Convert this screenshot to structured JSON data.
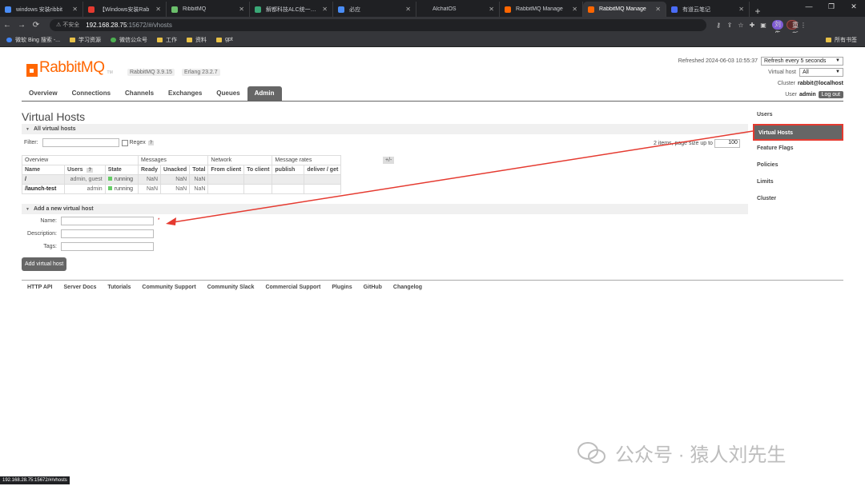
{
  "browser": {
    "tabs": [
      {
        "label": "windows 安装ribbit",
        "icon": "search-icon",
        "color": "#4a8df6"
      },
      {
        "label": "【Windows安装Rab",
        "icon": "csdn-icon",
        "color": "#e53a30"
      },
      {
        "label": "RibbitMQ",
        "icon": "list-icon",
        "color": "#6bbf6b"
      },
      {
        "label": "解都科技ALC统一监控",
        "icon": "leaf-icon",
        "color": "#3aa877"
      },
      {
        "label": "必应",
        "icon": "search-icon",
        "color": "#4a8df6"
      },
      {
        "label": "AlchatOS",
        "icon": "",
        "color": ""
      },
      {
        "label": "RabbitMQ Manage",
        "icon": "rabbitmq-icon",
        "color": "#f60"
      },
      {
        "label": "RabbitMQ Manage",
        "icon": "rabbitmq-icon",
        "color": "#f60"
      },
      {
        "label": "有道云笔记",
        "icon": "note-icon",
        "color": "#4a6cf6"
      }
    ],
    "new_tab": "+",
    "security": "不安全",
    "url_host": "192.168.28.75",
    "url_path": ":15672/#/vhosts",
    "restart_label": "重新启动即可更新",
    "avatar_text": "刘先",
    "bookmarks": [
      "微软 Bing 搜索 -...",
      "学习资源",
      "微信公众号",
      "工作",
      "资料",
      "gpt"
    ],
    "all_bookmarks": "所有书签",
    "status_url": "192.168.28.75:15672/#/vhosts"
  },
  "header": {
    "logo_text": "RabbitMQ",
    "logo_tm": "TM",
    "version": "RabbitMQ 3.9.15",
    "erlang": "Erlang 23.2.7",
    "refreshed": "Refreshed 2024-06-03 10:55:37",
    "refresh_select": "Refresh every 5 seconds",
    "vhost_label": "Virtual host",
    "vhost_select": "All",
    "cluster_label": "Cluster",
    "cluster_value": "rabbit@localhost",
    "user_label": "User",
    "user_value": "admin",
    "logout": "Log out"
  },
  "tabs": [
    "Overview",
    "Connections",
    "Channels",
    "Exchanges",
    "Queues",
    "Admin"
  ],
  "main": {
    "title": "Virtual Hosts",
    "all_vhosts": "All virtual hosts",
    "filter_label": "Filter:",
    "regex_label": "Regex",
    "help": "?",
    "page_info": "2 items, page size up to",
    "page_size": "100",
    "plusminus": "+/-",
    "group_headers": [
      "Overview",
      "Messages",
      "Network",
      "Message rates"
    ],
    "columns": [
      "Name",
      "Users",
      "State",
      "Ready",
      "Unacked",
      "Total",
      "From client",
      "To client",
      "publish",
      "deliver / get"
    ],
    "rows": [
      {
        "name": "/",
        "users": "admin, guest",
        "state": "running",
        "ready": "NaN",
        "unacked": "NaN",
        "total": "NaN"
      },
      {
        "name": "/launch-test",
        "users": "admin",
        "state": "running",
        "ready": "NaN",
        "unacked": "NaN",
        "total": "NaN"
      }
    ],
    "add_section": "Add a new virtual host",
    "name_label": "Name:",
    "desc_label": "Description:",
    "tags_label": "Tags:",
    "required_mark": "*",
    "add_button": "Add virtual host"
  },
  "footer": [
    "HTTP API",
    "Server Docs",
    "Tutorials",
    "Community Support",
    "Community Slack",
    "Commercial Support",
    "Plugins",
    "GitHub",
    "Changelog"
  ],
  "sidenav": [
    "Users",
    "Virtual Hosts",
    "Feature Flags",
    "Policies",
    "Limits",
    "Cluster"
  ],
  "watermark": "公众号 · 猿人刘先生",
  "colors": {
    "brand": "#ff6600",
    "highlight": "#e53a30",
    "tab_active": "#666666"
  }
}
